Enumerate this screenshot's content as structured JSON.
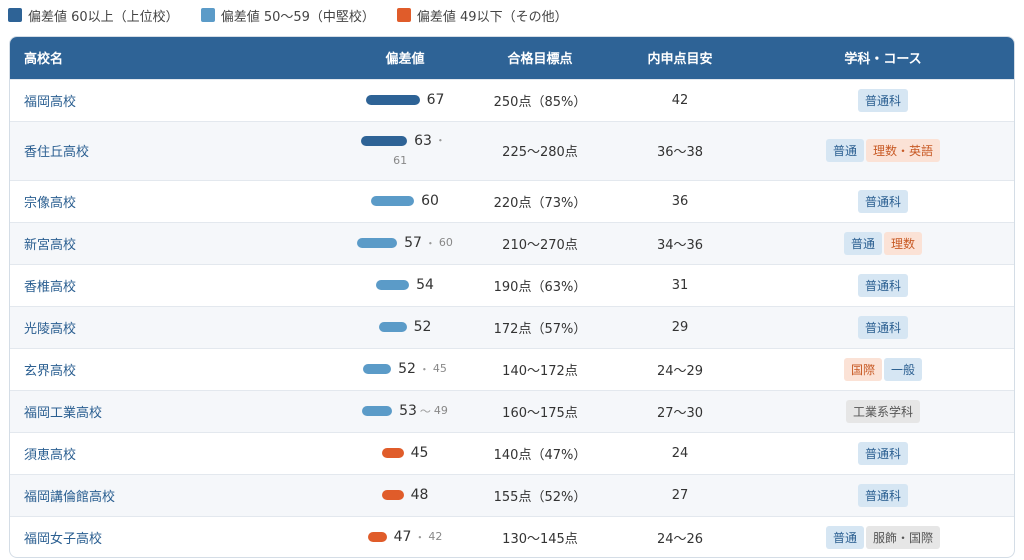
{
  "colors": {
    "top": "#2e6396",
    "mid": "#5b9bc8",
    "low": "#e05c2a",
    "header": "#2e6396"
  },
  "legend": [
    {
      "label": "偏差値 60以上（上位校）",
      "color": "#2e6396"
    },
    {
      "label": "偏差値 50〜59（中堅校）",
      "color": "#5b9bc8"
    },
    {
      "label": "偏差値 49以下（その他）",
      "color": "#e05c2a"
    }
  ],
  "table": {
    "headers": {
      "name": "高校名",
      "deviation": "偏差値",
      "target": "合格目標点",
      "naishin": "内申点目安",
      "course": "学科・コース"
    },
    "rows": [
      {
        "name": "福岡高校",
        "dev_main": "67",
        "dev_sep": "",
        "dev_sub": "",
        "level": "top",
        "bar_fraction": 1.0,
        "target": "250点（85%）",
        "naishin": "42",
        "tags": [
          {
            "label": "普通科",
            "style": "blue"
          }
        ]
      },
      {
        "name": "香住丘高校",
        "dev_main": "63",
        "dev_sep": "・",
        "dev_sub": "61",
        "level": "top",
        "bar_fraction": 0.85,
        "target": "225〜280点",
        "naishin": "36〜38",
        "tags": [
          {
            "label": "普通",
            "style": "blue"
          },
          {
            "label": "理数・英語",
            "style": "orange"
          }
        ]
      },
      {
        "name": "宗像高校",
        "dev_main": "60",
        "dev_sep": "",
        "dev_sub": "",
        "level": "mid",
        "bar_fraction": 0.8,
        "target": "220点（73%）",
        "naishin": "36",
        "tags": [
          {
            "label": "普通科",
            "style": "blue"
          }
        ]
      },
      {
        "name": "新宮高校",
        "dev_main": "57",
        "dev_sep": "・",
        "dev_sub": "60",
        "level": "mid",
        "bar_fraction": 0.74,
        "target": "210〜270点",
        "naishin": "34〜36",
        "tags": [
          {
            "label": "普通",
            "style": "blue"
          },
          {
            "label": "理数",
            "style": "orange"
          }
        ]
      },
      {
        "name": "香椎高校",
        "dev_main": "54",
        "dev_sep": "",
        "dev_sub": "",
        "level": "mid",
        "bar_fraction": 0.62,
        "target": "190点（63%）",
        "naishin": "31",
        "tags": [
          {
            "label": "普通科",
            "style": "blue"
          }
        ]
      },
      {
        "name": "光陵高校",
        "dev_main": "52",
        "dev_sep": "",
        "dev_sub": "",
        "level": "mid",
        "bar_fraction": 0.52,
        "target": "172点（57%）",
        "naishin": "29",
        "tags": [
          {
            "label": "普通科",
            "style": "blue"
          }
        ]
      },
      {
        "name": "玄界高校",
        "dev_main": "52",
        "dev_sep": "・",
        "dev_sub": "45",
        "level": "mid",
        "bar_fraction": 0.52,
        "target": "140〜172点",
        "naishin": "24〜29",
        "tags": [
          {
            "label": "国際",
            "style": "orange"
          },
          {
            "label": "一般",
            "style": "blue"
          }
        ]
      },
      {
        "name": "福岡工業高校",
        "dev_main": "53",
        "dev_sep": "〜",
        "dev_sub": "49",
        "level": "mid",
        "bar_fraction": 0.56,
        "target": "160〜175点",
        "naishin": "27〜30",
        "tags": [
          {
            "label": "工業系学科",
            "style": "gray"
          }
        ]
      },
      {
        "name": "須恵高校",
        "dev_main": "45",
        "dev_sep": "",
        "dev_sub": "",
        "level": "low",
        "bar_fraction": 0.4,
        "target": "140点（47%）",
        "naishin": "24",
        "tags": [
          {
            "label": "普通科",
            "style": "blue"
          }
        ]
      },
      {
        "name": "福岡講倫館高校",
        "dev_main": "48",
        "dev_sep": "",
        "dev_sub": "",
        "level": "low",
        "bar_fraction": 0.4,
        "target": "155点（52%）",
        "naishin": "27",
        "tags": [
          {
            "label": "普通科",
            "style": "blue"
          }
        ]
      },
      {
        "name": "福岡女子高校",
        "dev_main": "47",
        "dev_sep": "・",
        "dev_sub": "42",
        "level": "low",
        "bar_fraction": 0.35,
        "target": "130〜145点",
        "naishin": "24〜26",
        "tags": [
          {
            "label": "普通",
            "style": "blue"
          },
          {
            "label": "服飾・国際",
            "style": "gray"
          }
        ]
      }
    ]
  }
}
